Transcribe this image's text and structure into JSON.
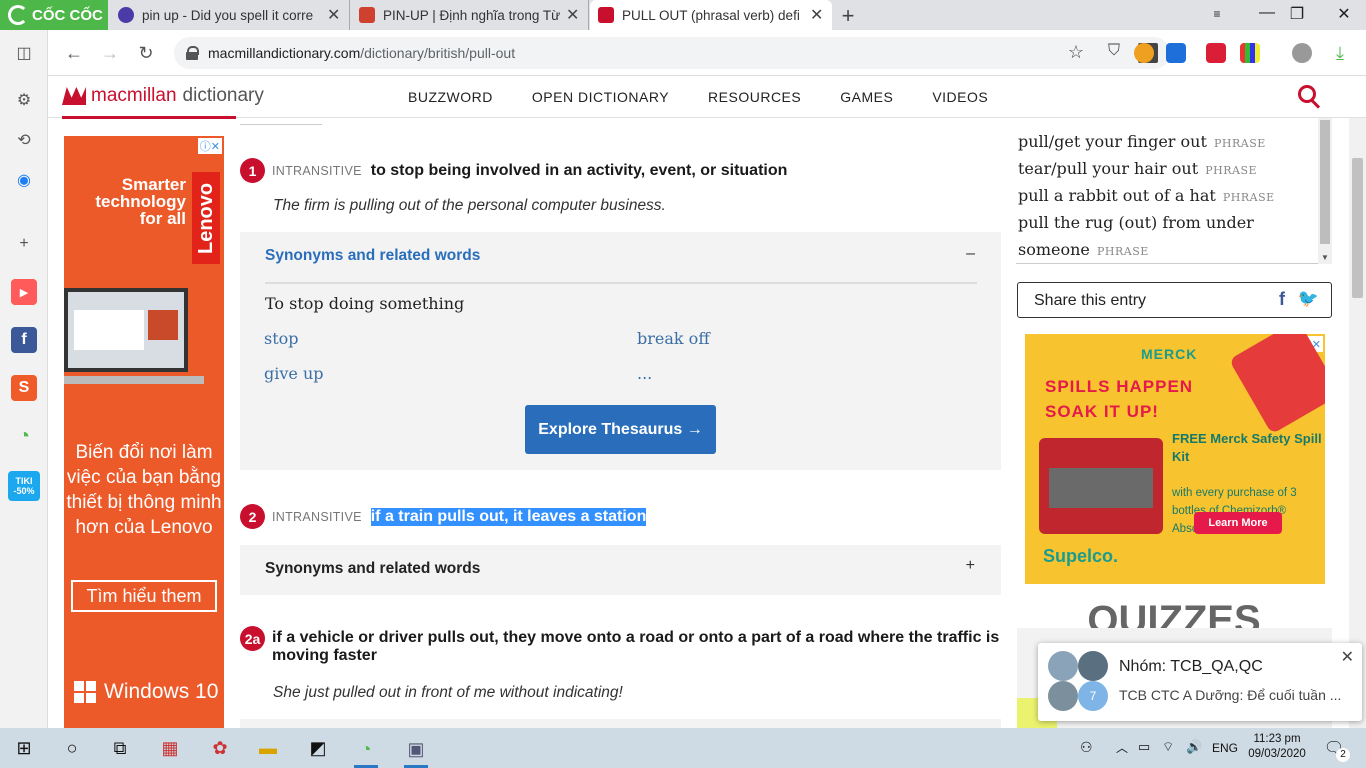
{
  "browser": {
    "brand": "CỐC CỐC",
    "tabs": [
      {
        "title": "pin up - Did you spell it corre",
        "active": false
      },
      {
        "title": "PIN-UP | Định nghĩa trong Từ",
        "active": false
      },
      {
        "title": "PULL OUT (phrasal verb) defi",
        "active": true
      }
    ],
    "new_tab": "+",
    "url_host": "macmillandictionary.com",
    "url_path": "/dictionary/british/pull-out",
    "window_controls": {
      "minimize": "—",
      "maximize": "❐",
      "close": "✕"
    },
    "icons": [
      "back-icon",
      "forward-icon",
      "reload-icon",
      "star-icon",
      "shield-icon",
      "download-icon"
    ]
  },
  "sidebar": {
    "icons": [
      "settings-icon",
      "history-icon",
      "messenger-icon",
      "add-icon",
      "youtube-icon",
      "facebook-icon",
      "shopee-icon",
      "coccoc-icon",
      "tiki-icon"
    ],
    "tiki_label": "TIKI -50%"
  },
  "site": {
    "logo_part1": "macmillan",
    "logo_part2": "dictionary",
    "nav": [
      "BUZZWORD",
      "OPEN DICTIONARY",
      "RESOURCES",
      "GAMES",
      "VIDEOS"
    ],
    "brand_color": "#c8102e"
  },
  "left_ad": {
    "headline": "Smarter technology for all",
    "brand": "Lenovo",
    "body": "Biến đổi nơi làm việc của bạn bằng thiết bị thông minh hơn của Lenovo",
    "cta": "Tìm hiểu them",
    "footer": "Windows 10"
  },
  "entry": {
    "senses": [
      {
        "num": "1",
        "grammar": "INTRANSITIVE",
        "definition": "to stop being involved in an activity, event, or situation",
        "example": "The firm is pulling out of the personal computer business.",
        "synonyms": {
          "header": "Synonyms and related words",
          "toggle": "–",
          "subheading": "To stop doing something",
          "words": [
            "stop",
            "break off",
            "give up",
            "..."
          ],
          "button": "Explore Thesaurus →"
        }
      },
      {
        "num": "2",
        "grammar": "INTRANSITIVE",
        "definition": "if a train pulls out, it leaves a station",
        "synonyms": {
          "header": "Synonyms and related words",
          "toggle": "+"
        }
      },
      {
        "num": "2a",
        "definition": "if a vehicle or driver pulls out, they move onto a road or onto a part of a road where the traffic is moving faster",
        "example": "She just pulled out in front of me without indicating!"
      }
    ]
  },
  "related_phrases": [
    {
      "text": "pull/get your finger out",
      "tag": "PHRASE"
    },
    {
      "text": "tear/pull your hair out",
      "tag": "PHRASE"
    },
    {
      "text": "pull a rabbit out of a hat",
      "tag": "PHRASE"
    },
    {
      "text": "pull the rug (out) from under",
      "tag": ""
    },
    {
      "text": "someone",
      "tag": "PHRASE"
    }
  ],
  "share": {
    "label": "Share this entry",
    "fb": "f",
    "tw": "🐦"
  },
  "right_ad": {
    "brand": "MERCK",
    "headline1": "SPILLS HAPPEN",
    "headline2": "SOAK IT UP!",
    "offer_title": "FREE Merck Safety Spill Kit",
    "offer_body": "with every purchase of 3 bottles of Chemizorb® Absorbents",
    "cta": "Learn More",
    "footer": "Supelco."
  },
  "quizzes_title": "QUIZZES",
  "notification": {
    "title": "Nhóm: TCB_QA,QC",
    "message": "TCB CTC A Dưỡng: Để cuối tuần ...",
    "badge": "7"
  },
  "taskbar": {
    "lang": "ENG",
    "time": "11:23 pm",
    "date": "09/03/2020",
    "notif_count": "2"
  }
}
